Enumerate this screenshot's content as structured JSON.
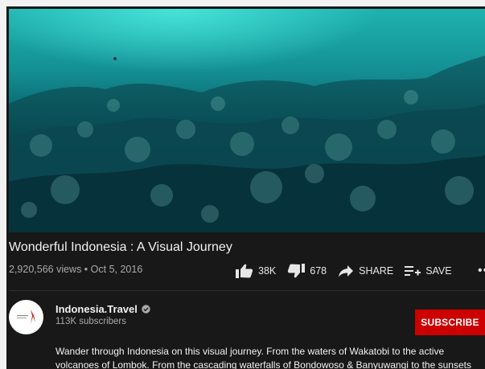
{
  "video": {
    "title": "Wonderful Indonesia : A Visual Journey",
    "meta": "2,920,566 views • Oct 5, 2016"
  },
  "actions": {
    "like_count": "38K",
    "dislike_count": "678",
    "share_label": "SHARE",
    "save_label": "SAVE",
    "more_label": "•••"
  },
  "channel": {
    "name": "Indonesia.Travel",
    "subscribers": "113K subscribers",
    "subscribe_label": "SUBSCRIBE"
  },
  "description": {
    "line1": "Wander through Indonesia on this visual journey. From the waters of Wakatobi to the active",
    "line2": "volcanoes of Lombok. From the cascading waterfalls of Bondowoso & Banyuwangi to the sunsets"
  },
  "colors": {
    "subscribe": "#cc0000",
    "background": "#181818",
    "water_top": "#1fb3b0",
    "water_bottom": "#07353f"
  },
  "icons": [
    "thumb-up-icon",
    "thumb-down-icon",
    "share-arrow-icon",
    "playlist-add-icon",
    "verified-icon",
    "more-icon"
  ]
}
